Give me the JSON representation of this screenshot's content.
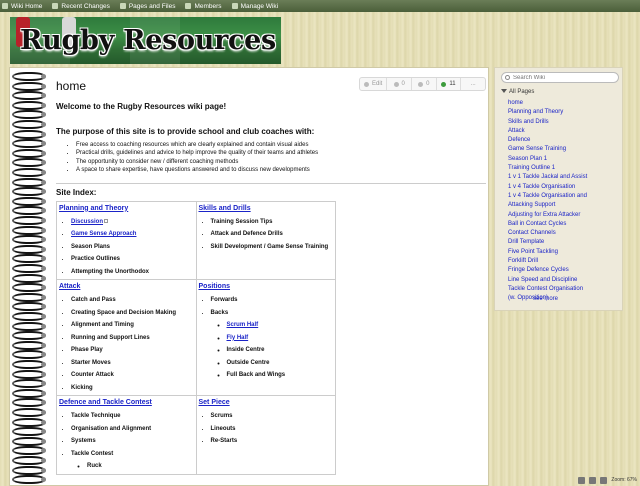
{
  "topbar": {
    "items": [
      {
        "label": "Wiki Home",
        "icon": "home-icon"
      },
      {
        "label": "Recent Changes",
        "icon": "clock-icon"
      },
      {
        "label": "Pages and Files",
        "icon": "pages-icon"
      },
      {
        "label": "Members",
        "icon": "members-icon"
      },
      {
        "label": "Manage Wiki",
        "icon": "wrench-icon"
      }
    ]
  },
  "banner": {
    "title": "Rugby Resources"
  },
  "page": {
    "title": "home",
    "actions": {
      "edit": "Edit",
      "comments": "0",
      "watch": "0",
      "views": "11",
      "more": "..."
    }
  },
  "content": {
    "welcome": "Welcome to the Rugby Resources wiki page!",
    "purpose": "The purpose of this site is to provide school and club coaches with:",
    "purpose_items": [
      "Free access to coaching resources which are clearly explained and contain visual aides",
      "Practical drills, guidelines and advice to help improve the quality of their teams and athletes",
      "The opportunity to consider new / different coaching methods",
      "A space to share expertise, have questions answered and to discuss new developments"
    ],
    "index_title": "Site Index:",
    "index": {
      "r1": {
        "left": {
          "cat": "Planning and Theory",
          "items": [
            "Discussion",
            "Game Sense Approach",
            "Season Plans",
            "Practice Outlines",
            "Attempting the Unorthodox"
          ]
        },
        "right": {
          "cat": "Skills and Drills",
          "items": [
            "Training Session Tips",
            "Attack and Defence Drills",
            "Skill Development / Game Sense Training"
          ]
        }
      },
      "r2": {
        "left": {
          "cat": "Attack",
          "items": [
            "Catch and Pass",
            "Creating Space and Decision Making",
            "Alignment and Timing",
            "Running and Support Lines",
            "Phase Play",
            "Starter Moves",
            "Counter Attack",
            "Kicking"
          ]
        },
        "right": {
          "cat": "Positions",
          "items": [
            "Forwards",
            "Backs"
          ],
          "sub": [
            "Scrum Half",
            "Fly Half",
            "Inside Centre",
            "Outside Centre",
            "Full Back and Wings"
          ]
        }
      },
      "r3": {
        "left": {
          "cat": "Defence and Tackle Contest",
          "items": [
            "Tackle Technique",
            "Organisation and Alignment",
            "Systems",
            "Tackle Contest"
          ],
          "sub": [
            "Ruck"
          ]
        },
        "right": {
          "cat": "Set Piece",
          "items": [
            "Scrums",
            "Lineouts",
            "Re-Starts"
          ]
        }
      }
    }
  },
  "sidebar": {
    "search_placeholder": "Search Wiki",
    "all_pages": "All Pages",
    "pages": [
      "home",
      "Planning and Theory",
      "Skills and Drills",
      "Attack",
      "Defence",
      "Game Sense Training",
      "Season Plan 1",
      "Training Outline 1",
      "1 v 1 Tackle Jackal and Assist",
      "1 v 4 Tackle Organisation",
      "1 v 4 Tackle Organisation and",
      "Attacking Support",
      "Adjusting for Extra Attacker",
      "Ball in Contact Cycles",
      "Contact Channels",
      "Drill Template",
      "Five Point Tackling",
      "Forklift Drill",
      "Fringe Defence Cycles",
      "Line Speed and Discipline",
      "Tackle Contest Organisation",
      "(w. Opposition)"
    ],
    "see_more": "see more"
  },
  "status": {
    "zoom": "Zoom: 67%"
  }
}
